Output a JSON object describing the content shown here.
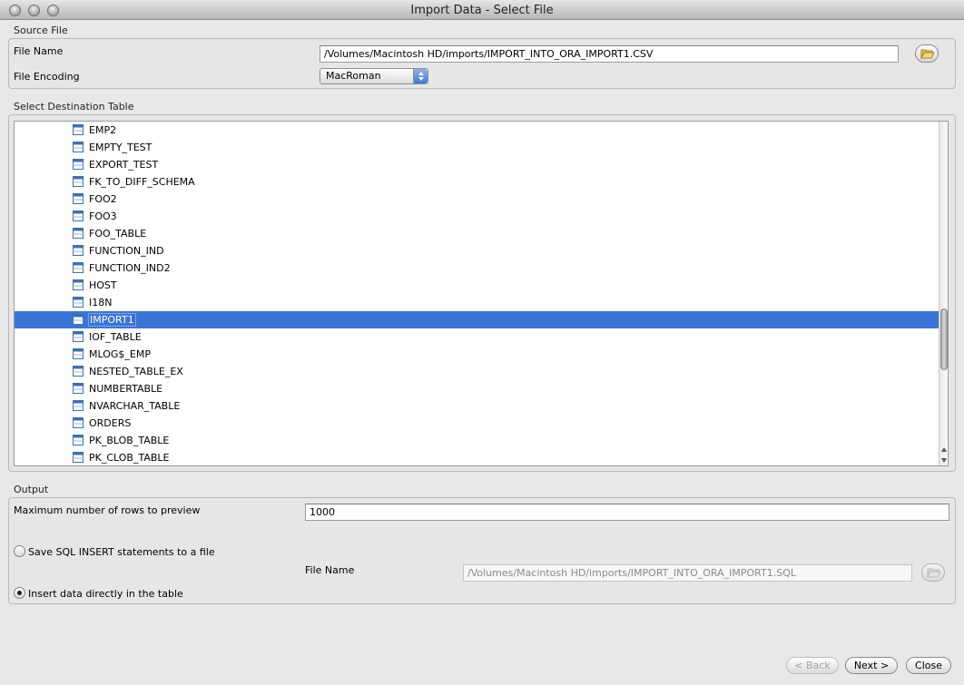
{
  "window": {
    "title": "Import Data - Select File"
  },
  "source_file": {
    "section_label": "Source File",
    "file_name_label": "File Name",
    "file_name_value": "/Volumes/Macintosh HD/imports/IMPORT_INTO_ORA_IMPORT1.CSV",
    "browse_icon": "folder-open-icon",
    "encoding_label": "File Encoding",
    "encoding_value": "MacRoman"
  },
  "destination": {
    "section_label": "Select Destination Table",
    "table_icon": "table-icon",
    "tables": [
      "EMP2",
      "EMPTY_TEST",
      "EXPORT_TEST",
      "FK_TO_DIFF_SCHEMA",
      "FOO2",
      "FOO3",
      "FOO_TABLE",
      "FUNCTION_IND",
      "FUNCTION_IND2",
      "HOST",
      "I18N",
      "IMPORT1",
      "IOF_TABLE",
      "MLOG$_EMP",
      "NESTED_TABLE_EX",
      "NUMBERTABLE",
      "NVARCHAR_TABLE",
      "ORDERS",
      "PK_BLOB_TABLE",
      "PK_CLOB_TABLE"
    ],
    "selected": "IMPORT1"
  },
  "output": {
    "section_label": "Output",
    "max_rows_label": "Maximum number of rows to preview",
    "max_rows_value": "1000",
    "save_sql_label": "Save SQL INSERT statements to a file",
    "file_name_label": "File Name",
    "file_name_value": "/Volumes/Macintosh HD/imports/IMPORT_INTO_ORA_IMPORT1.SQL",
    "insert_direct_label": "Insert data directly in the table",
    "selected_option": "insert_direct"
  },
  "buttons": {
    "back": "< Back",
    "next": "Next >",
    "close": "Close"
  },
  "colors": {
    "selection": "#3875d7"
  }
}
